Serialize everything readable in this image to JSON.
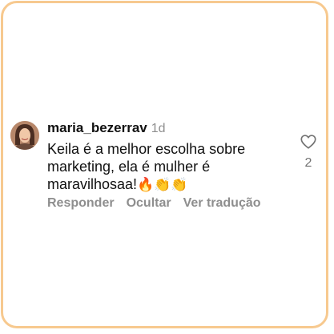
{
  "comment": {
    "username": "maria_bezerrav",
    "time": "1d",
    "text_line1": "Keila é a melhor escolha sobre",
    "text_line2": "marketing, ela é mulher é",
    "text_line3": "maravilhosaa!",
    "emojis": "🔥👏👏",
    "like_count": "2"
  },
  "actions": {
    "reply": "Responder",
    "hide": "Ocultar",
    "translate": "Ver tradução"
  },
  "icons": {
    "like": "heart-outline-icon"
  },
  "colors": {
    "frame_border": "#f7c98f",
    "muted_text": "#8e8e8e"
  }
}
